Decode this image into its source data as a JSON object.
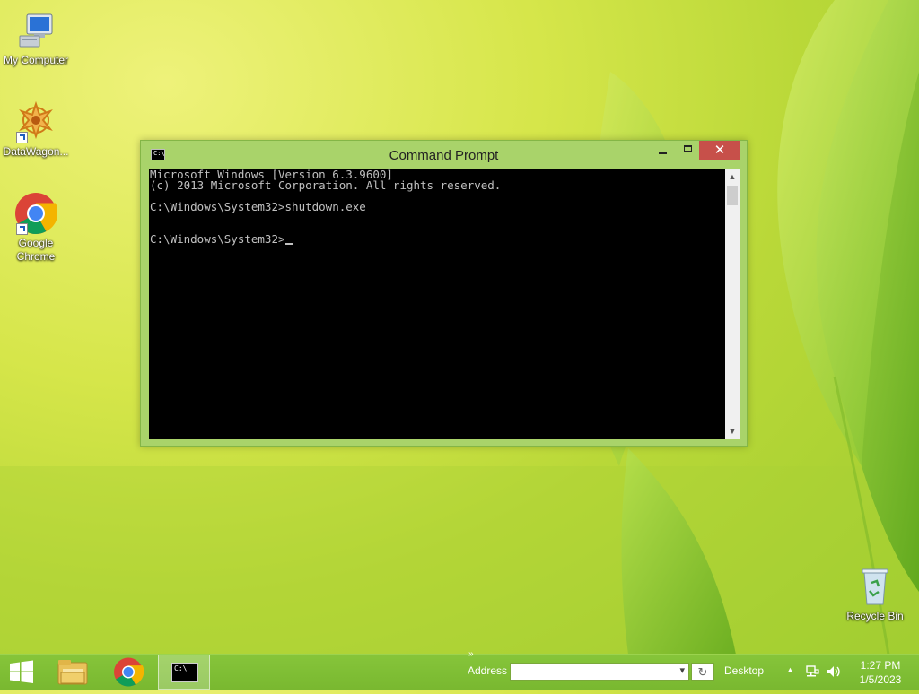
{
  "desktop": {
    "icons": [
      {
        "label": "My Computer"
      },
      {
        "label": "DataWagon..."
      },
      {
        "label": "Google Chrome"
      },
      {
        "label": "Recycle Bin"
      }
    ]
  },
  "window": {
    "title": "Command Prompt",
    "icon_text": "C:\\",
    "close_glyph": "✕",
    "console_lines": [
      "Microsoft Windows [Version 6.3.9600]",
      "(c) 2013 Microsoft Corporation. All rights reserved.",
      "",
      "C:\\Windows\\System32>shutdown.exe",
      "",
      ""
    ],
    "prompt": "C:\\Windows\\System32>"
  },
  "taskbar": {
    "cmd_icon_text": "C:\\_",
    "toolbar_chevron": "»",
    "address_label": "Address",
    "address_value": "",
    "desktop_label": "Desktop",
    "tray_chevron": "▲",
    "time": "1:27 PM",
    "date": "1/5/2023"
  },
  "colors": {
    "accent": "#a9d36a",
    "taskbar": "#7dbc33",
    "close": "#c7504a"
  }
}
